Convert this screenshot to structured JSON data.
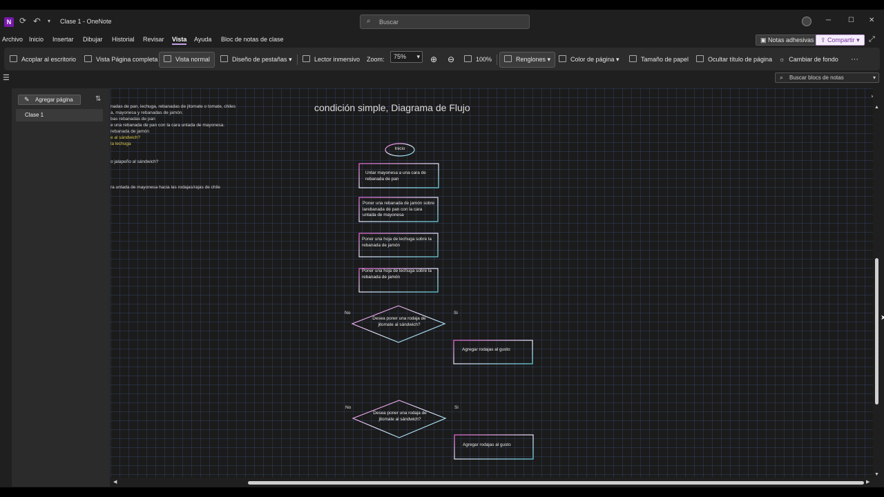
{
  "titlebar": {
    "app_icon": "N",
    "title": "Clase 1  -  OneNote",
    "search_placeholder": "Buscar",
    "icons": [
      "onenote-icon",
      "sync-icon",
      "undo-icon",
      "chevron-down-icon",
      "search-icon",
      "avatar",
      "minimize-icon",
      "maximize-icon",
      "close-icon"
    ]
  },
  "menu": {
    "items": [
      "Archivo",
      "Inicio",
      "Insertar",
      "Dibujar",
      "Historial",
      "Revisar",
      "Vista",
      "Ayuda",
      "Bloc de notas de clase"
    ],
    "active": "Vista",
    "notas_adhesivas": "Notas adhesivas",
    "compartir": "Compartir"
  },
  "ribbon": {
    "acoplar": "Acoplar al escritorio",
    "pagina_completa": "Vista Página completa",
    "vista_normal": "Vista normal",
    "diseno_pestanas": "Diseño de pestañas",
    "lector": "Lector inmersivo",
    "zoom_label": "Zoom:",
    "zoom_value": "75%",
    "zoom_100": "100%",
    "renglones": "Renglones",
    "color_pagina": "Color de página",
    "tamano_papel": "Tamaño de papel",
    "ocultar_titulo": "Ocultar título de página",
    "cambiar_fondo": "Cambiar de fondo",
    "more": "···"
  },
  "notebook_search": "Buscar blocs de notas",
  "pagelist": {
    "add_page": "Agregar página",
    "pages": [
      "Clase 1"
    ]
  },
  "notes": {
    "lines": [
      "nadas de pan, lechuga, rebanadas de jitomate o tomate, chiles",
      "a, mayonesa y rebanadas de jamón.",
      "bas rebanadas de pan",
      "e una rebanada de pan con la cara untada de mayonesa.",
      "rebanada de jamón",
      "e al sándwich?",
      " la lechuga",
      "o jalapeño al sándwich?",
      "ra untada de mayonesa hacia las rodajas/rajas de chile"
    ]
  },
  "page": {
    "title": "condición simple, Diagrama de Flujo"
  },
  "flowchart": {
    "start": "Inicio",
    "step1": "Untar mayonesa a una cara de rebanada de pan",
    "step2": "Poner una rebanada de jamón sobre larebanada de pan con la cara untada de mayonesa",
    "step3": "Poner una hoja de lechuga sobre la rebanada de jamón",
    "step4": "Poner una hoja de lechuga sobre la rebanada de jamón",
    "decision1": "Desea poner una rodaja de jitomate al sándwich?",
    "decision1_no": "No",
    "decision1_yes": "Si",
    "action1": "Agregar rodajas al gusto",
    "decision2": "Desea poner una rodaja de jitomate al sándwich?",
    "decision2_no": "No",
    "decision2_yes": "Si",
    "action2": "Agregar rodajas al gusto"
  },
  "colors": {
    "accent_purple": "#7719aa",
    "canvas_bg": "#1b1b1b",
    "grid": "#465f96",
    "note_highlight": "#d7c64a"
  }
}
